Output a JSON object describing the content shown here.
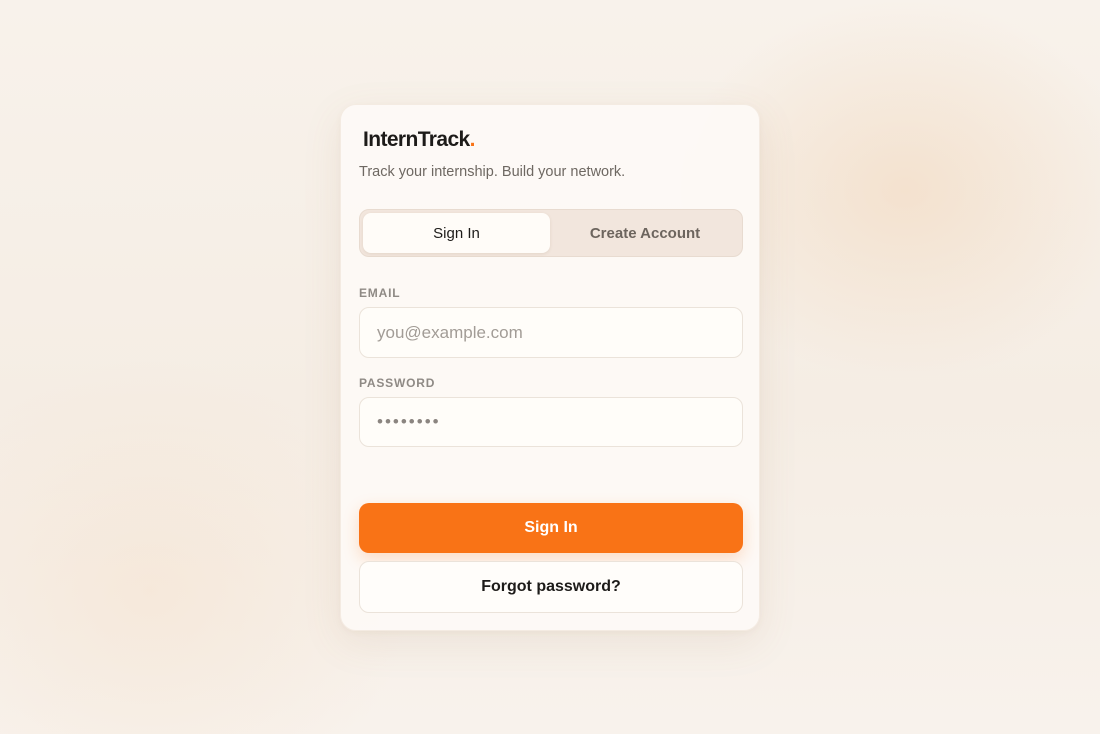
{
  "brand": {
    "name": "InternTrack",
    "dot": "."
  },
  "tagline": "Track your internship. Build your network.",
  "tabs": [
    {
      "label": "Sign In",
      "active": true
    },
    {
      "label": "Create Account",
      "active": false
    }
  ],
  "form": {
    "email": {
      "label": "EMAIL",
      "placeholder": "you@example.com",
      "value": ""
    },
    "password": {
      "label": "PASSWORD",
      "placeholder": "••••••••",
      "value": ""
    }
  },
  "actions": {
    "submit_label": "Sign In",
    "forgot_label": "Forgot password?"
  },
  "colors": {
    "accent": "#f97316",
    "background": "#f6efe7",
    "card": "#fdfaf6",
    "text": "#1d1b19",
    "muted": "#6e6862"
  }
}
